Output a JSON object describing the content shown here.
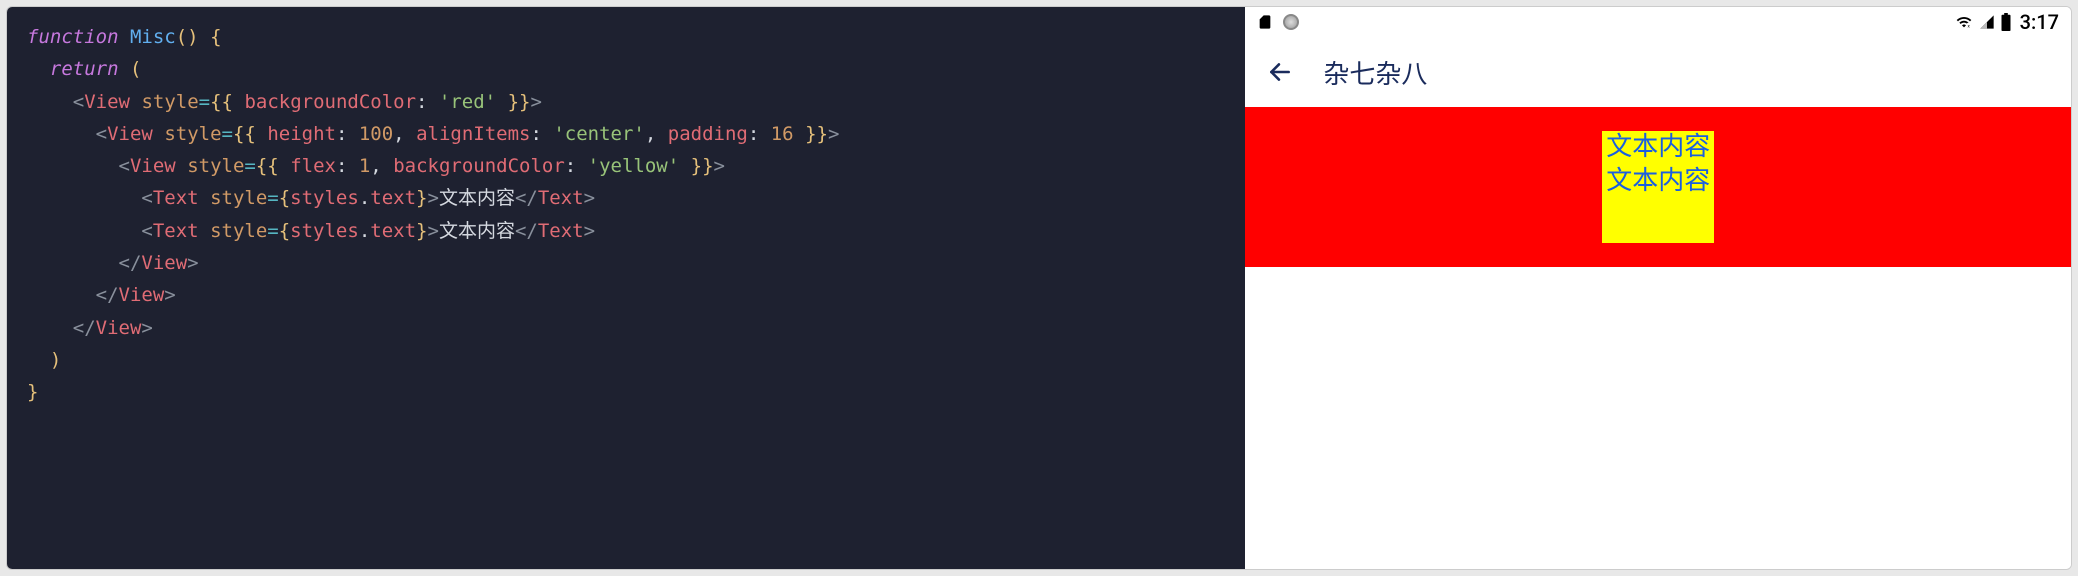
{
  "code": {
    "fn_keyword": "function",
    "fn_name": "Misc",
    "return_kw": "return",
    "tag_view": "View",
    "tag_text": "Text",
    "attr_style": "style",
    "key_bg": "backgroundColor",
    "key_height": "height",
    "key_align": "alignItems",
    "key_padding": "padding",
    "key_flex": "flex",
    "val_red": "'red'",
    "val_center": "'center'",
    "val_yellow": "'yellow'",
    "val_100": "100",
    "val_16": "16",
    "val_1": "1",
    "styles_ref": "styles",
    "text_ref": "text",
    "text_content": "文本内容"
  },
  "phone": {
    "statusbar": {
      "time": "3:17"
    },
    "appbar": {
      "title": "杂七杂八"
    },
    "render": {
      "text1": "文本内容",
      "text2": "文本内容"
    }
  }
}
